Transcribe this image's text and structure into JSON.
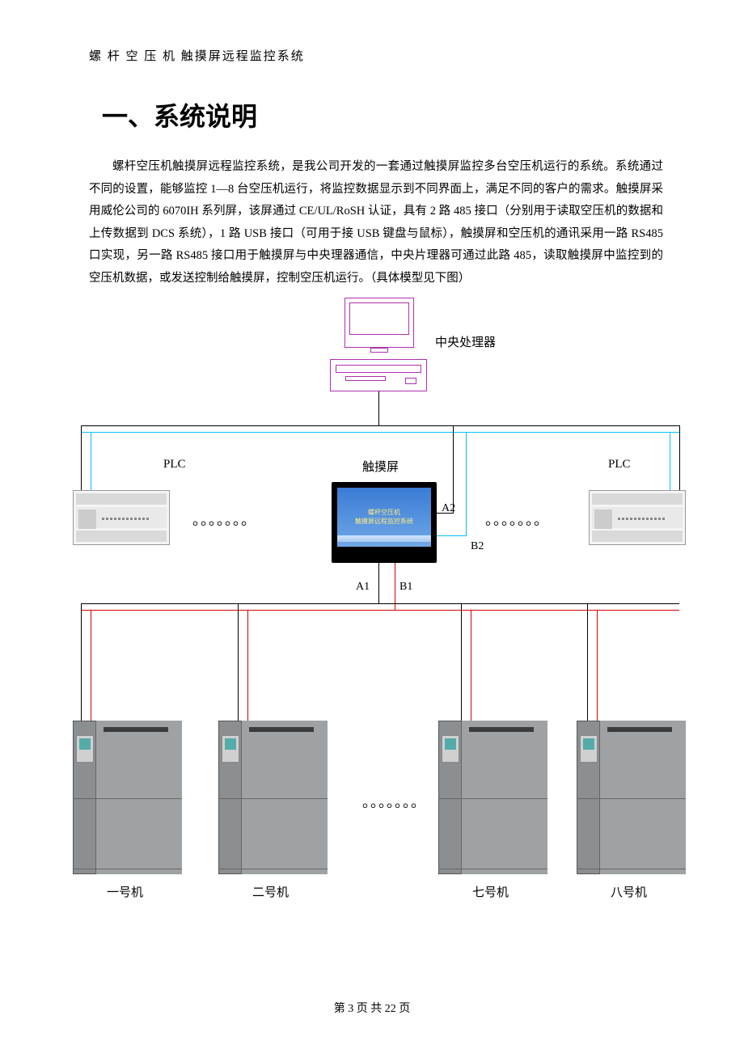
{
  "header": "螺 杆 空 压 机 触摸屏远程监控系统",
  "heading": "一、系统说明",
  "paragraph": "螺杆空压机触摸屏远程监控系统，是我公司开发的一套通过触摸屏监控多台空压机运行的系统。系统通过不同的设置，能够监控 1—8 台空压机运行，将监控数据显示到不同界面上，满足不同的客户的需求。触摸屏采用威伦公司的 6070IH 系列屏，该屏通过 CE/UL/RoSH 认证，具有 2 路 485 接口（分别用于读取空压机的数据和上传数据到 DCS 系统），1 路 USB 接口（可用于接 USB 键盘与鼠标），触摸屏和空压机的通讯采用一路 RS485 口实现，另一路 RS485 接口用于触摸屏与中央理器通信，中央片理器可通过此路 485，读取触摸屏中监控到的空压机数据，或发送控制给触摸屏，控制空压机运行。（具体模型见下图）",
  "diagram": {
    "cpu_label": "中央处理器",
    "plc_left": "PLC",
    "plc_right": "PLC",
    "touchscreen_label": "触摸屏",
    "touchscreen_text1": "螺杆空压机",
    "touchscreen_text2": "触摸屏远程监控系统",
    "port_a2": "A2",
    "port_b2": "B2",
    "port_a1": "A1",
    "port_b1": "B1",
    "units": [
      "一号机",
      "二号机",
      "七号机",
      "八号机"
    ]
  },
  "footer": "第 3 页 共 22 页"
}
